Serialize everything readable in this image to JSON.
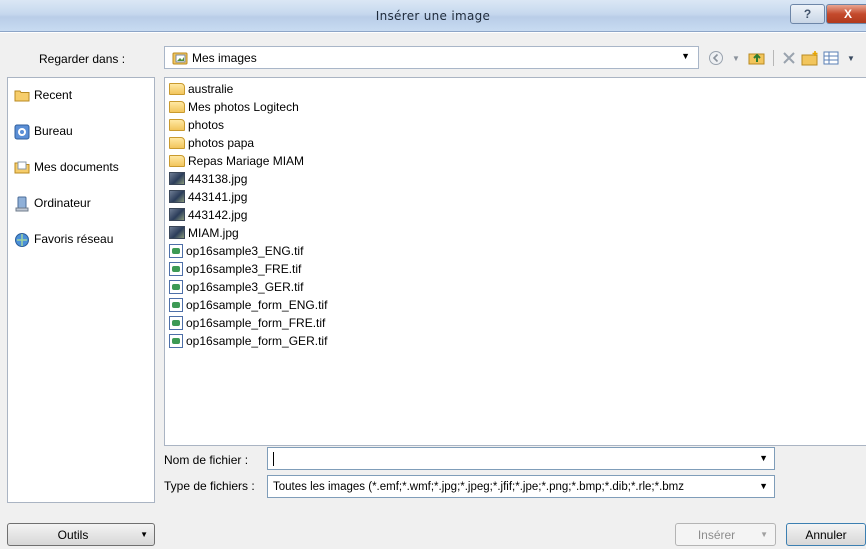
{
  "window": {
    "title": "Insérer une image",
    "help_label": "?",
    "close_label": "X"
  },
  "lookin": {
    "label": "Regarder dans :",
    "value": "Mes images"
  },
  "toolbar": {
    "icons": [
      "back-icon",
      "up-folder-icon",
      "delete-icon",
      "new-folder-icon",
      "views-icon"
    ]
  },
  "places": [
    {
      "label": "Recent",
      "icon": "recent-folder-icon"
    },
    {
      "label": "Bureau",
      "icon": "desktop-icon"
    },
    {
      "label": "Mes documents",
      "icon": "documents-folder-icon"
    },
    {
      "label": "Ordinateur",
      "icon": "computer-icon"
    },
    {
      "label": "Favoris réseau",
      "icon": "network-icon"
    }
  ],
  "files": [
    {
      "name": "australie",
      "type": "folder"
    },
    {
      "name": "Mes photos Logitech",
      "type": "folder"
    },
    {
      "name": "photos",
      "type": "folder"
    },
    {
      "name": "photos papa",
      "type": "folder"
    },
    {
      "name": "Repas Mariage MIAM",
      "type": "folder"
    },
    {
      "name": "443138.jpg",
      "type": "jpg"
    },
    {
      "name": "443141.jpg",
      "type": "jpg"
    },
    {
      "name": "443142.jpg",
      "type": "jpg"
    },
    {
      "name": "MIAM.jpg",
      "type": "jpg"
    },
    {
      "name": "op16sample3_ENG.tif",
      "type": "tif"
    },
    {
      "name": "op16sample3_FRE.tif",
      "type": "tif"
    },
    {
      "name": "op16sample3_GER.tif",
      "type": "tif"
    },
    {
      "name": "op16sample_form_ENG.tif",
      "type": "tif"
    },
    {
      "name": "op16sample_form_FRE.tif",
      "type": "tif"
    },
    {
      "name": "op16sample_form_GER.tif",
      "type": "tif"
    }
  ],
  "filename": {
    "label": "Nom de fichier :",
    "value": ""
  },
  "filetype": {
    "label": "Type de fichiers :",
    "value": "Toutes les images (*.emf;*.wmf;*.jpg;*.jpeg;*.jfif;*.jpe;*.png;*.bmp;*.dib;*.rle;*.bmz"
  },
  "buttons": {
    "tools": "Outils",
    "insert": "Insérer",
    "cancel": "Annuler"
  },
  "colors": {
    "title_bar": "#c6d8ee",
    "close_button": "#c44a2c",
    "dialog_bg": "#f0f0f0"
  }
}
